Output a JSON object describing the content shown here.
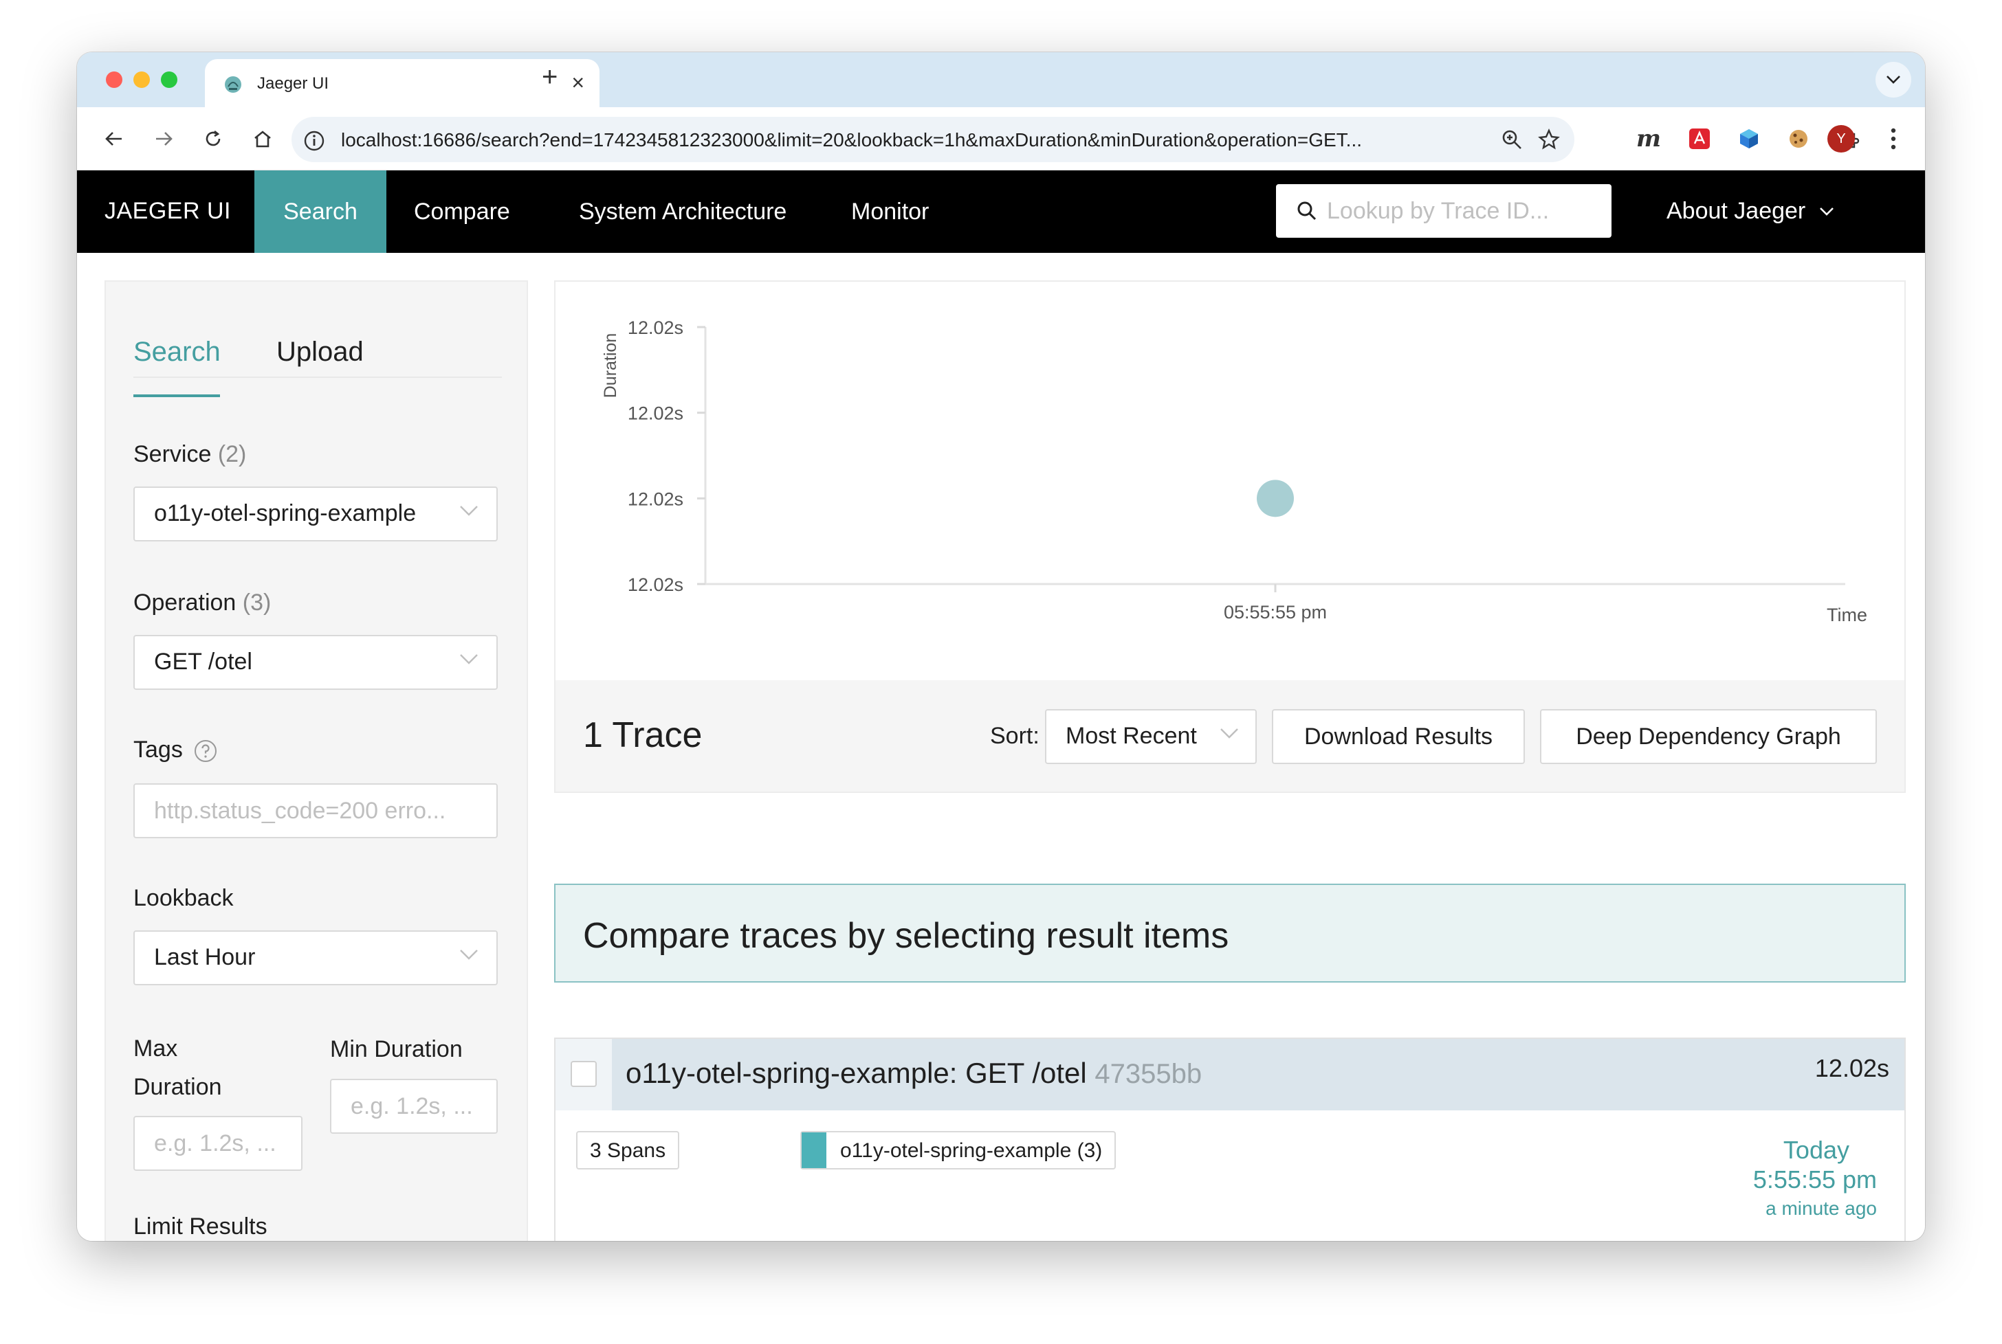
{
  "browser": {
    "tab_title": "Jaeger UI",
    "url": "localhost:16686/search?end=1742345812323000&limit=20&lookback=1h&maxDuration&minDuration&operation=GET...",
    "profile_initial": "Y",
    "extension_m": "m"
  },
  "nav": {
    "brand": "JAEGER UI",
    "items": [
      {
        "label": "Search",
        "active": true
      },
      {
        "label": "Compare"
      },
      {
        "label": "System Architecture"
      },
      {
        "label": "Monitor"
      }
    ],
    "lookup_placeholder": "Lookup by Trace ID...",
    "about": "About Jaeger"
  },
  "sidebar": {
    "tabs": [
      {
        "label": "Search",
        "active": true
      },
      {
        "label": "Upload"
      }
    ],
    "service": {
      "label": "Service",
      "count": "(2)",
      "value": "o11y-otel-spring-example"
    },
    "operation": {
      "label": "Operation",
      "count": "(3)",
      "value": "GET /otel"
    },
    "tags": {
      "label": "Tags",
      "placeholder": "http.status_code=200 erro..."
    },
    "lookback": {
      "label": "Lookback",
      "value": "Last Hour"
    },
    "max_duration": {
      "label_line1": "Max",
      "label_line2": "Duration",
      "placeholder": "e.g. 1.2s, ..."
    },
    "min_duration": {
      "label": "Min Duration",
      "placeholder": "e.g. 1.2s, ..."
    },
    "limit_results": {
      "label": "Limit Results"
    }
  },
  "chart_data": {
    "type": "scatter",
    "ylabel": "Duration",
    "xlabel": "Time",
    "y_ticks": [
      "12.02s",
      "12.02s",
      "12.02s",
      "12.02s"
    ],
    "x_ticks": [
      "05:55:55 pm"
    ],
    "points": [
      {
        "x": "05:55:55 pm",
        "y": "12.02s"
      }
    ],
    "grid": false,
    "point_color": "#a8cfd3"
  },
  "results": {
    "count_label": "1 Trace",
    "sort_label": "Sort:",
    "sort_value": "Most Recent",
    "download_label": "Download Results",
    "ddg_label": "Deep Dependency Graph"
  },
  "compare_banner": "Compare traces by selecting result items",
  "trace": {
    "title": "o11y-otel-spring-example: GET /otel",
    "trace_id": "47355bb",
    "duration": "12.02s",
    "spans": "3 Spans",
    "service_tag": "o11y-otel-spring-example (3)",
    "service_color": "#4db2b8",
    "date": "Today",
    "time": "5:55:55 pm",
    "ago": "a minute ago"
  },
  "colors": {
    "accent": "#449ea0",
    "nav_bg": "#000000"
  }
}
